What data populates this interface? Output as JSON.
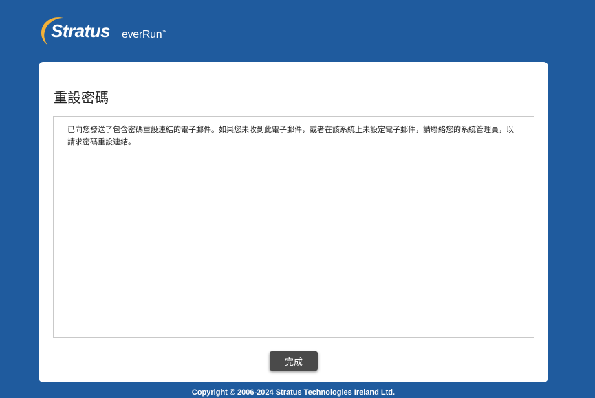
{
  "colors": {
    "background": "#1f5b9e",
    "card": "#ffffff",
    "button": "#4a4a4a",
    "logo_swoosh": "#f2b138"
  },
  "logo": {
    "brand": "Stratus",
    "product": "everRun",
    "trademark": "™"
  },
  "dialog": {
    "title": "重設密碼",
    "message": "已向您發送了包含密碼重設連結的電子郵件。如果您未收到此電子郵件，或者在該系統上未設定電子郵件，請聯絡您的系統管理員，以請求密碼重設連結。",
    "done_label": "完成"
  },
  "footer": {
    "copyright": "Copyright © 2006-2024 Stratus Technologies Ireland Ltd."
  }
}
